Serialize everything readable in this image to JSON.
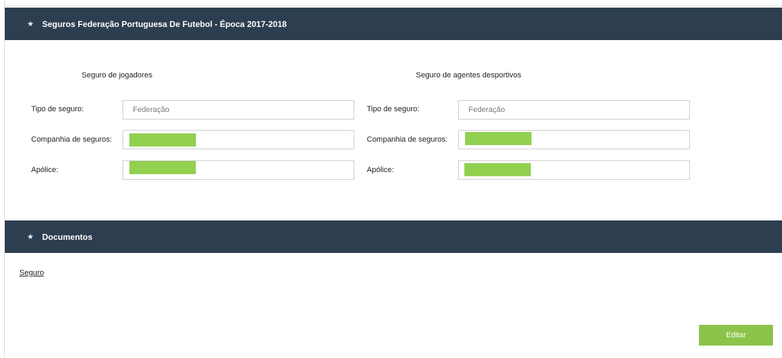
{
  "header": {
    "title": "Seguros Federação Portuguesa De Futebol - Época 2017-2018",
    "icon": "star-icon"
  },
  "players": {
    "title": "Seguro de jogadores",
    "type_label": "Tipo de seguro:",
    "type_value": "Federação",
    "company_label": "Companhia de seguros:",
    "policy_label": "Apólice:"
  },
  "agents": {
    "title": "Seguro de agentes desportivos",
    "type_label": "Tipo de seguro:",
    "type_value": "Federação",
    "company_label": "Companhia de seguros:",
    "policy_label": "Apólice:"
  },
  "documents": {
    "title": "Documentos",
    "icon": "star-icon",
    "link": "Seguro"
  },
  "actions": {
    "edit": "Editar"
  },
  "colors": {
    "header_bg": "#2d3e50",
    "button": "#8cc34a",
    "redaction": "#92d050"
  }
}
